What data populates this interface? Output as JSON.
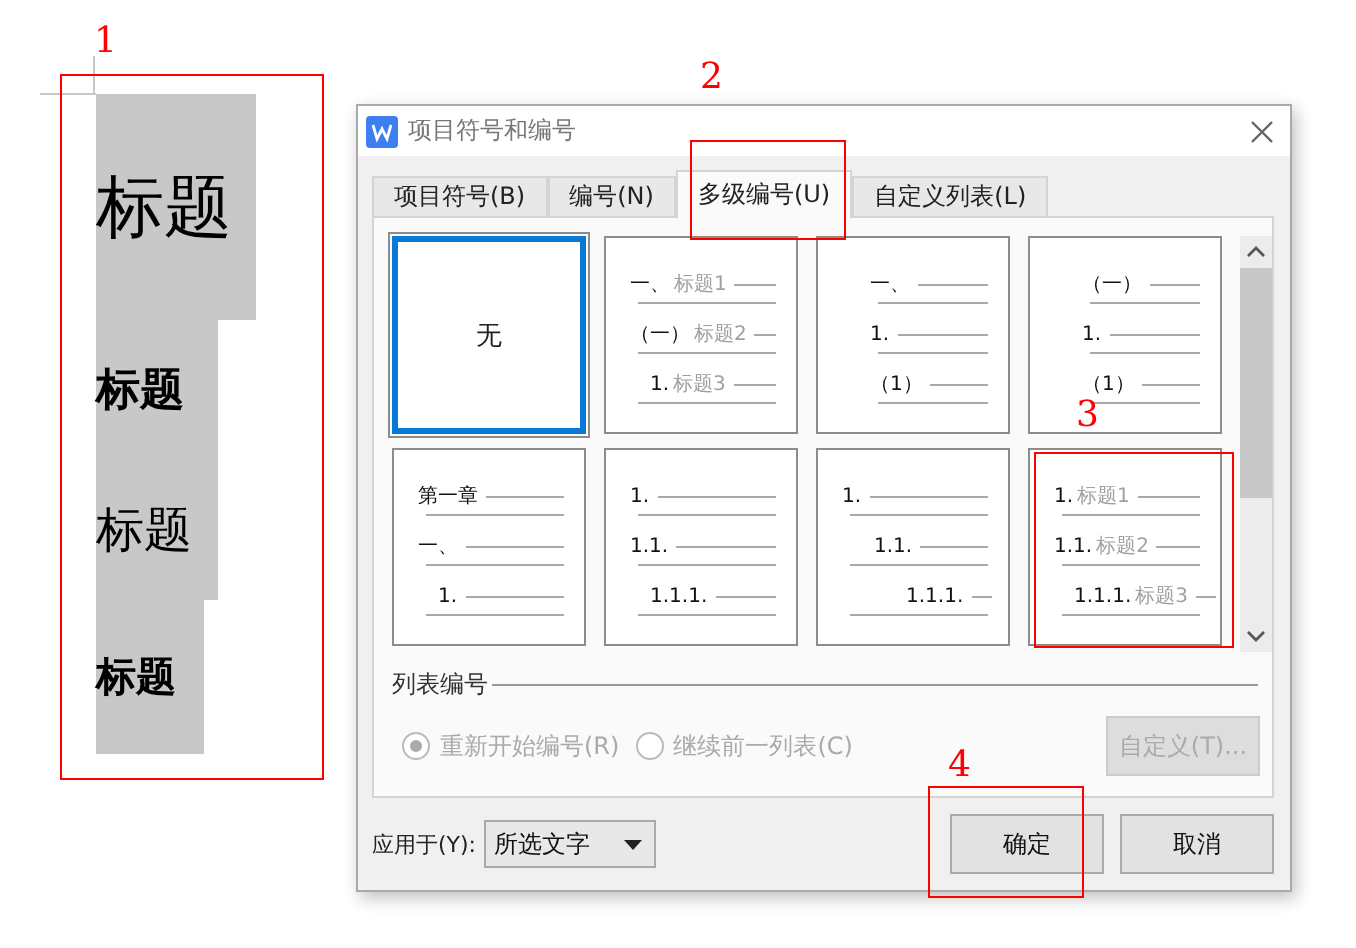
{
  "annotations": [
    {
      "label": "1"
    },
    {
      "label": "2"
    },
    {
      "label": "3"
    },
    {
      "label": "4"
    }
  ],
  "document": {
    "headings": [
      {
        "text": "标题",
        "bold": false
      },
      {
        "text": "标题",
        "bold": true
      },
      {
        "text": "标题",
        "bold": false
      },
      {
        "text": "标题",
        "bold": true
      }
    ]
  },
  "dialog": {
    "title": "项目符号和编号",
    "tabs": [
      {
        "label": "项目符号(B)",
        "selected": false
      },
      {
        "label": "编号(N)",
        "selected": false
      },
      {
        "label": "多级编号(U)",
        "selected": true
      },
      {
        "label": "自定义列表(L)",
        "selected": false
      }
    ],
    "presets": [
      {
        "kind": "none",
        "label": "无",
        "selected": true
      },
      {
        "kind": "flat",
        "selected": false,
        "levels": [
          {
            "number": "一、",
            "text": "标题1"
          },
          {
            "number": "（一）",
            "text": "标题2"
          },
          {
            "number": "1.",
            "text": "标题3"
          }
        ]
      },
      {
        "kind": "centered",
        "selected": false,
        "levels": [
          {
            "number": "一、"
          },
          {
            "number": "1."
          },
          {
            "number": "（1）"
          }
        ]
      },
      {
        "kind": "centered",
        "selected": false,
        "levels": [
          {
            "number": "（一）"
          },
          {
            "number": "1."
          },
          {
            "number": "（1）"
          }
        ]
      },
      {
        "kind": "flat",
        "selected": false,
        "levels": [
          {
            "number": "第一章"
          },
          {
            "number": "一、"
          },
          {
            "number": "1."
          }
        ]
      },
      {
        "kind": "flat",
        "selected": false,
        "levels": [
          {
            "number": "1."
          },
          {
            "number": "1.1."
          },
          {
            "number": "1.1.1."
          }
        ]
      },
      {
        "kind": "stepped",
        "selected": false,
        "levels": [
          {
            "number": "1."
          },
          {
            "number": "1.1."
          },
          {
            "number": "1.1.1."
          }
        ]
      },
      {
        "kind": "flat",
        "selected": false,
        "levels": [
          {
            "number": "1.",
            "text": "标题1"
          },
          {
            "number": "1.1.",
            "text": "标题2"
          },
          {
            "number": "1.1.1.",
            "text": "标题3"
          }
        ]
      }
    ],
    "section_label": "列表编号",
    "radios": [
      {
        "label": "重新开始编号(R)",
        "selected": true,
        "disabled": true
      },
      {
        "label": "继续前一列表(C)",
        "selected": false,
        "disabled": true
      }
    ],
    "custom_button": {
      "label": "自定义(T)...",
      "disabled": true
    },
    "apply_to": {
      "label": "应用于(Y):",
      "value": "所选文字"
    },
    "buttons": [
      "确定",
      "取消"
    ]
  }
}
